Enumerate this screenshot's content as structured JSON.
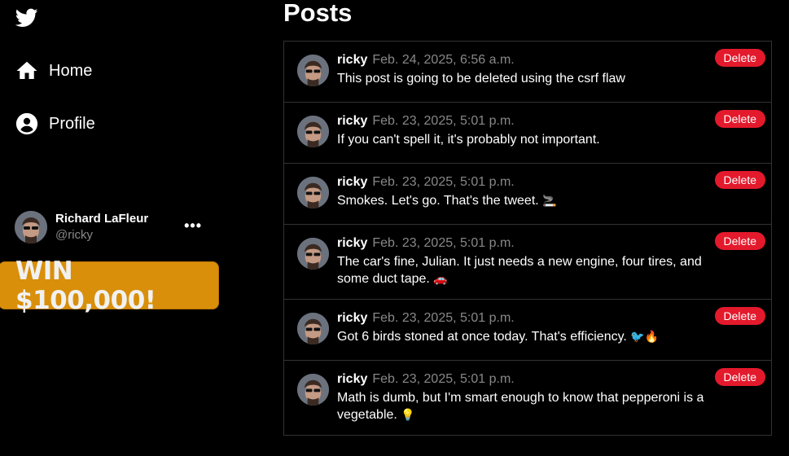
{
  "sidebar": {
    "logo_icon": "twitter-bird-icon",
    "nav": [
      {
        "label": "Home",
        "icon": "home-icon"
      },
      {
        "label": "Profile",
        "icon": "profile-icon"
      }
    ],
    "profile": {
      "name": "Richard LaFleur",
      "handle": "@ricky",
      "more": "•••"
    },
    "promo_label": "WIN $100,000!"
  },
  "main": {
    "title": "Posts",
    "delete_label": "Delete",
    "posts": [
      {
        "user": "ricky",
        "date": "Feb. 24, 2025, 6:56 a.m.",
        "text": "This post is going to be deleted using the csrf flaw",
        "emoji": ""
      },
      {
        "user": "ricky",
        "date": "Feb. 23, 2025, 5:01 p.m.",
        "text": "If you can't spell it, it's probably not important.",
        "emoji": ""
      },
      {
        "user": "ricky",
        "date": "Feb. 23, 2025, 5:01 p.m.",
        "text": "Smokes. Let's go. That's the tweet.",
        "emoji": "🚬"
      },
      {
        "user": "ricky",
        "date": "Feb. 23, 2025, 5:01 p.m.",
        "text": "The car's fine, Julian. It just needs a new engine, four tires, and some duct tape.",
        "emoji": "🚗"
      },
      {
        "user": "ricky",
        "date": "Feb. 23, 2025, 5:01 p.m.",
        "text": "Got 6 birds stoned at once today. That's efficiency.",
        "emoji": "🐦🔥"
      },
      {
        "user": "ricky",
        "date": "Feb. 23, 2025, 5:01 p.m.",
        "text": "Math is dumb, but I'm smart enough to know that pepperoni is a vegetable.",
        "emoji": "💡"
      }
    ]
  },
  "colors": {
    "background": "#000000",
    "delete": "#e3192c",
    "promo": "#d98f0a",
    "muted": "#888888"
  }
}
